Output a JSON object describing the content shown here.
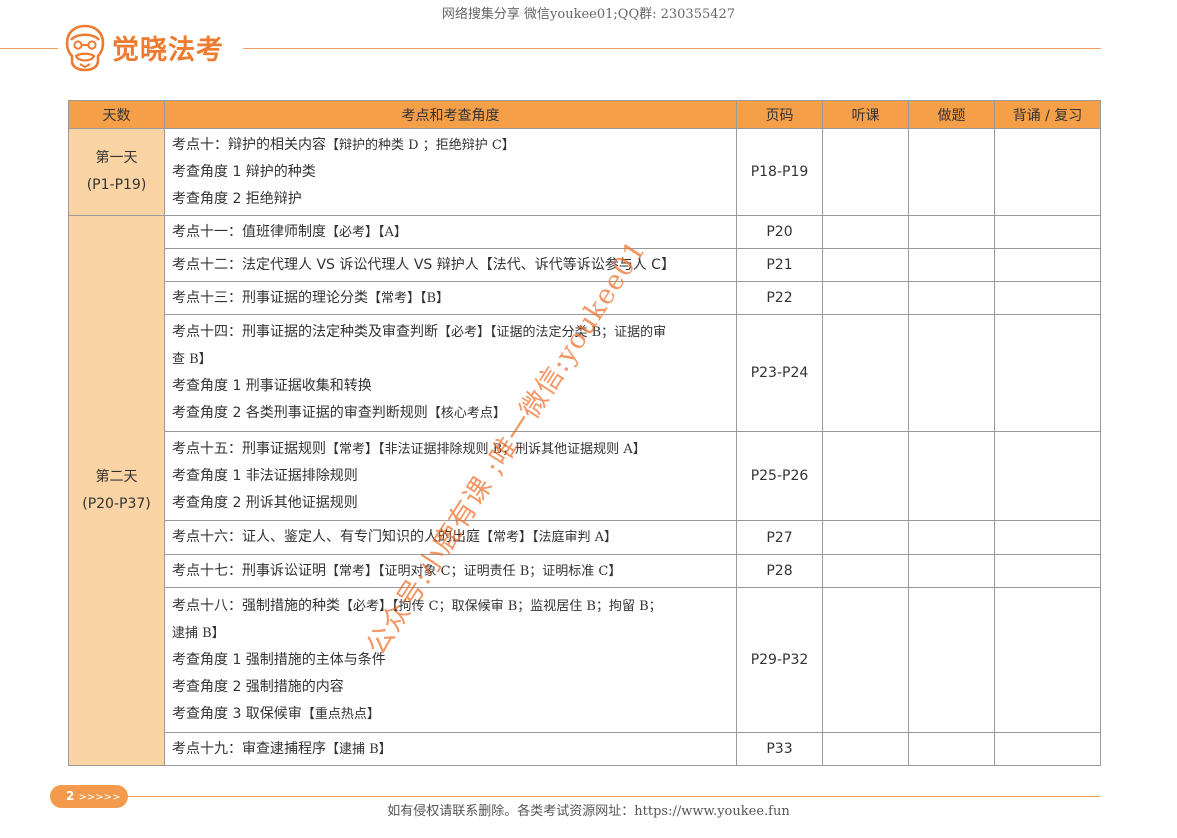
{
  "top_note": "网络搜集分享 微信youkee01;QQ群: 230355427",
  "brand": {
    "name": "觉晓法考",
    "color": "#ee7b2f",
    "logo_icon": "face-logo-icon"
  },
  "table": {
    "headers": [
      "天数",
      "考点和考查角度",
      "页码",
      "听课",
      "做题",
      "背诵 / 复习"
    ],
    "groups": [
      {
        "day": [
          "第一天",
          "(P1-P19)"
        ],
        "rows": [
          {
            "lines": [
              {
                "text": "考点十：辩护的相关内容",
                "tag": "【辩护的种类 D ；拒绝辩护 C】"
              },
              {
                "text": "考查角度 1 辩护的种类",
                "tag": ""
              },
              {
                "text": "考查角度 2 拒绝辩护",
                "tag": ""
              }
            ],
            "page": "P18-P19"
          }
        ]
      },
      {
        "day": [
          "第二天",
          "(P20-P37)"
        ],
        "rows": [
          {
            "lines": [
              {
                "text": "考点十一：值班律师制度",
                "tag": "【必考】【A】"
              }
            ],
            "page": "P20"
          },
          {
            "lines": [
              {
                "text": "考点十二：法定代理人 VS 诉讼代理人 VS 辩护人【法代、诉代等诉讼参与人 C】",
                "tag": ""
              }
            ],
            "page": "P21"
          },
          {
            "lines": [
              {
                "text": "考点十三：刑事证据的理论分类",
                "tag": "【常考】【B】"
              }
            ],
            "page": "P22"
          },
          {
            "lines": [
              {
                "text": "考点十四：刑事证据的法定种类及审查判断",
                "tag": "【必考】【证据的法定分类 B；证据的审"
              },
              {
                "text": "",
                "tag": "查 B】"
              },
              {
                "text": "考查角度 1 刑事证据收集和转换",
                "tag": ""
              },
              {
                "text": "考查角度 2 各类刑事证据的审查判断规则",
                "tag": "【核心考点】"
              }
            ],
            "page": "P23-P24"
          },
          {
            "lines": [
              {
                "text": "考点十五：刑事证据规则",
                "tag": "【常考】【非法证据排除规则 B；刑诉其他证据规则 A】"
              },
              {
                "text": "考查角度 1 非法证据排除规则",
                "tag": ""
              },
              {
                "text": "考查角度 2 刑诉其他证据规则",
                "tag": ""
              }
            ],
            "page": "P25-P26"
          },
          {
            "lines": [
              {
                "text": "考点十六：证人、鉴定人、有专门知识的人的出庭",
                "tag": "【常考】【法庭审判 A】"
              }
            ],
            "page": "P27"
          },
          {
            "lines": [
              {
                "text": "考点十七：刑事诉讼证明",
                "tag": "【常考】【证明对象 C；证明责任 B；证明标准 C】"
              }
            ],
            "page": "P28"
          },
          {
            "lines": [
              {
                "text": "考点十八：强制措施的种类",
                "tag": "【必考】【拘传 C；取保候审 B；监视居住 B；拘留 B；"
              },
              {
                "text": "",
                "tag": "逮捕 B】"
              },
              {
                "text": "考查角度 1 强制措施的主体与条件",
                "tag": ""
              },
              {
                "text": "考查角度 2 强制措施的内容",
                "tag": ""
              },
              {
                "text": "考查角度 3 取保候审",
                "tag": "【重点热点】"
              }
            ],
            "page": "P29-P32"
          },
          {
            "lines": [
              {
                "text": "考点十九：审查逮捕程序",
                "tag": "【逮捕 B】"
              }
            ],
            "page": "P33"
          }
        ]
      }
    ]
  },
  "watermark": "公众号:小鹿有课 ;唯一微信:youkee01",
  "footer": {
    "page_number": "2",
    "arrows": ">>>>>",
    "note": "如有侵权请联系删除。各类考试资源网址：https://www.youkee.fun"
  },
  "colors": {
    "header_bg": "#f5a048",
    "day_bg": "#fbd4a6",
    "accent": "#f49a4d"
  }
}
